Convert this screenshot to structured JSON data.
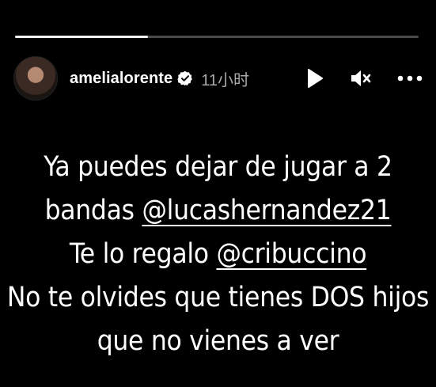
{
  "story": {
    "progress": 0.33,
    "progress_color": "#f2f2f2",
    "track_color": "#4a4a4a"
  },
  "header": {
    "username": "amelialorente",
    "verified_icon": "verified-badge-icon",
    "timestamp": "11小时",
    "controls": [
      "play-icon",
      "mute-icon",
      "more-icon"
    ]
  },
  "caption": {
    "line1": "Ya puedes dejar de jugar a 2",
    "line2_prefix": "bandas ",
    "line2_mention": "@lucashernandez21",
    "line3_prefix": "Te lo regalo ",
    "line3_mention": "@cribuccino",
    "line4": "No te olvides que tienes DOS hijos",
    "line5": "que no vienes a ver"
  }
}
